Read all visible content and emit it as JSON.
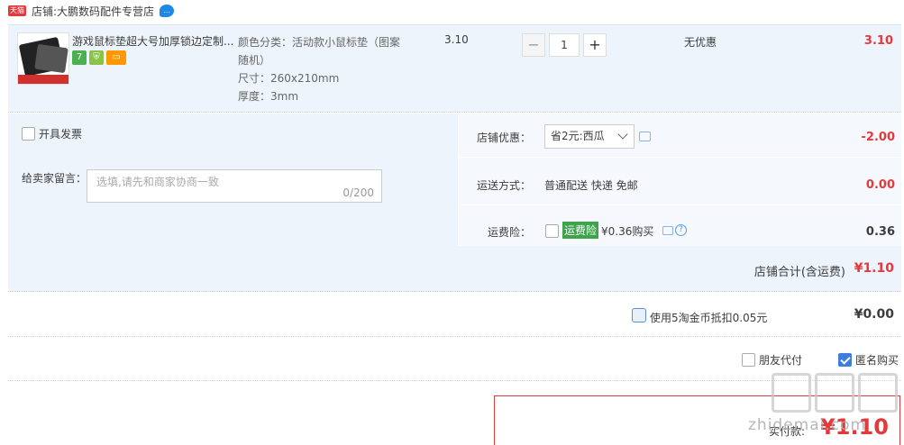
{
  "shop": {
    "badge": "天猫",
    "label": "店铺:",
    "name": "大鹏数码配件专营店"
  },
  "item": {
    "title": "游戏鼠标垫超大号加厚锁边定制...",
    "sku_line1": "颜色分类：活动款小鼠标垫（图案",
    "sku_line2": "随机）",
    "sku_size": "尺寸：260x210mm",
    "sku_thickness": "厚度：3mm",
    "unit_price": "3.10",
    "quantity": "1",
    "minus": "−",
    "plus": "+",
    "discount": "无优惠",
    "subtotal": "3.10",
    "service_icons": [
      "7",
      "⛨",
      "▭"
    ]
  },
  "options": {
    "invoice_label": "开具发票",
    "message_label": "给卖家留言：",
    "message_placeholder": "选填,请先和商家协商一致",
    "message_count": "0/200"
  },
  "coupon": {
    "label": "店铺优惠：",
    "selected": "省2元:西瓜",
    "value": "-2.00"
  },
  "shipping": {
    "label": "运送方式：",
    "method": "普通配送 快递 免邮",
    "value": "0.00"
  },
  "insurance": {
    "label": "运费险：",
    "tag": "运费险",
    "price": "¥0.36购买",
    "help": "?",
    "value": "0.36"
  },
  "shop_total": {
    "label": "店铺合计(含运费)",
    "value": "¥1.10"
  },
  "coins": {
    "text": "使用5淘金币抵扣0.05元",
    "value": "¥0.00"
  },
  "pay": {
    "friend_label": "朋友代付",
    "anon_label": "匿名购买",
    "anon_checked": true
  },
  "final": {
    "label": "实付款:",
    "value": "¥1.10"
  },
  "watermark": {
    "text": "zhidemai.com"
  },
  "colors": {
    "accent": "#e4393c",
    "row_bg": "#eef4fb",
    "link_blue": "#3d7de0"
  }
}
